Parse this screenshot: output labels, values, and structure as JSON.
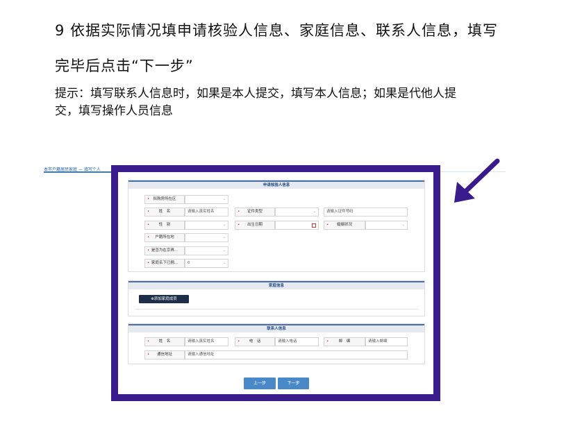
{
  "doc": {
    "line1": "9 依据实际情况填申请核验人信息、家庭信息、联系人信息，填写",
    "line2": "完毕后点击“下一步”",
    "line3": "提示：填写联系人信息时，如果是本人提交，填写本人信息；如果是代他人提",
    "line4": "交，填写操作人员信息"
  },
  "breadcrumb": "本市户籍居民家庭 — 填写个人",
  "applicant": {
    "title": "申请核验人信息",
    "fields": [
      {
        "label": "拟购房所在区",
        "value": ""
      },
      {
        "label": "姓　名",
        "value": "请输入真实姓名"
      },
      {
        "label": "证件类型",
        "value": ""
      },
      {
        "label": "",
        "value": "请输入证件号码"
      },
      {
        "label": "性　别",
        "value": ""
      },
      {
        "label": "出生日期",
        "value": ""
      },
      {
        "label": "婚姻状况",
        "value": ""
      },
      {
        "label": "户籍所在地",
        "value": ""
      },
      {
        "label": "是否为在京再...",
        "value": ""
      },
      {
        "label": "家庭名下已拥...",
        "value": "0"
      }
    ]
  },
  "family": {
    "title": "家庭信息",
    "add_button": "⊕添加家庭成员"
  },
  "contact": {
    "title": "联系人信息",
    "name_label": "姓　名",
    "name_placeholder": "请输入真实姓名",
    "phone_label": "电　话",
    "phone_placeholder": "请输入电话",
    "zip_label": "邮　编",
    "zip_placeholder": "请输入邮编",
    "address_label": "通信地址",
    "address_placeholder": "请输入通信地址"
  },
  "buttons": {
    "prev": "上一步",
    "next": "下一步"
  },
  "colors": {
    "frame": "#3a1b8c",
    "arrow": "#3a1b8c",
    "primary_button": "#4a89c8",
    "add_button": "#1f2f4a"
  },
  "icons": [
    "arrow-icon",
    "chevron-down-icon",
    "calendar-icon"
  ]
}
